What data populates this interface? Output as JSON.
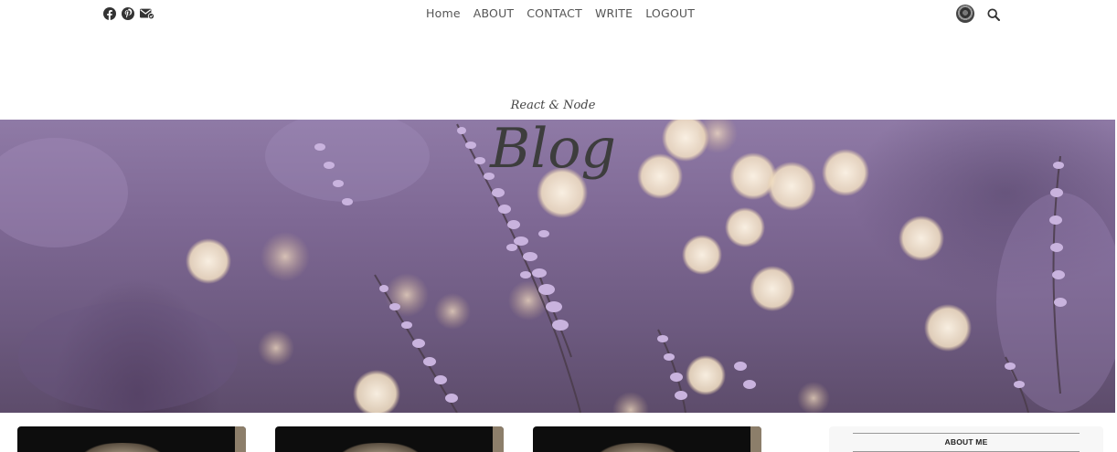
{
  "social": {
    "icons": [
      "facebook-icon",
      "pinterest-icon",
      "mail-check-icon"
    ]
  },
  "nav": {
    "items": [
      {
        "label": "Home"
      },
      {
        "label": "ABOUT"
      },
      {
        "label": "CONTACT"
      },
      {
        "label": "WRITE"
      },
      {
        "label": "LOGOUT"
      }
    ]
  },
  "tools": {
    "avatar": "user-avatar",
    "search": "search-icon"
  },
  "header": {
    "subtitle": "React & Node",
    "title": "Blog"
  },
  "colors": {
    "hero_base": "#7e6894",
    "text_dark": "#3d3d3d",
    "card_bg": "#0d0d0d",
    "sidebar_bg": "#f7f7f7"
  },
  "posts": [
    {
      "image": "post-thumbnail"
    },
    {
      "image": "post-thumbnail"
    },
    {
      "image": "post-thumbnail"
    }
  ],
  "sidebar": {
    "title": "ABOUT ME"
  }
}
